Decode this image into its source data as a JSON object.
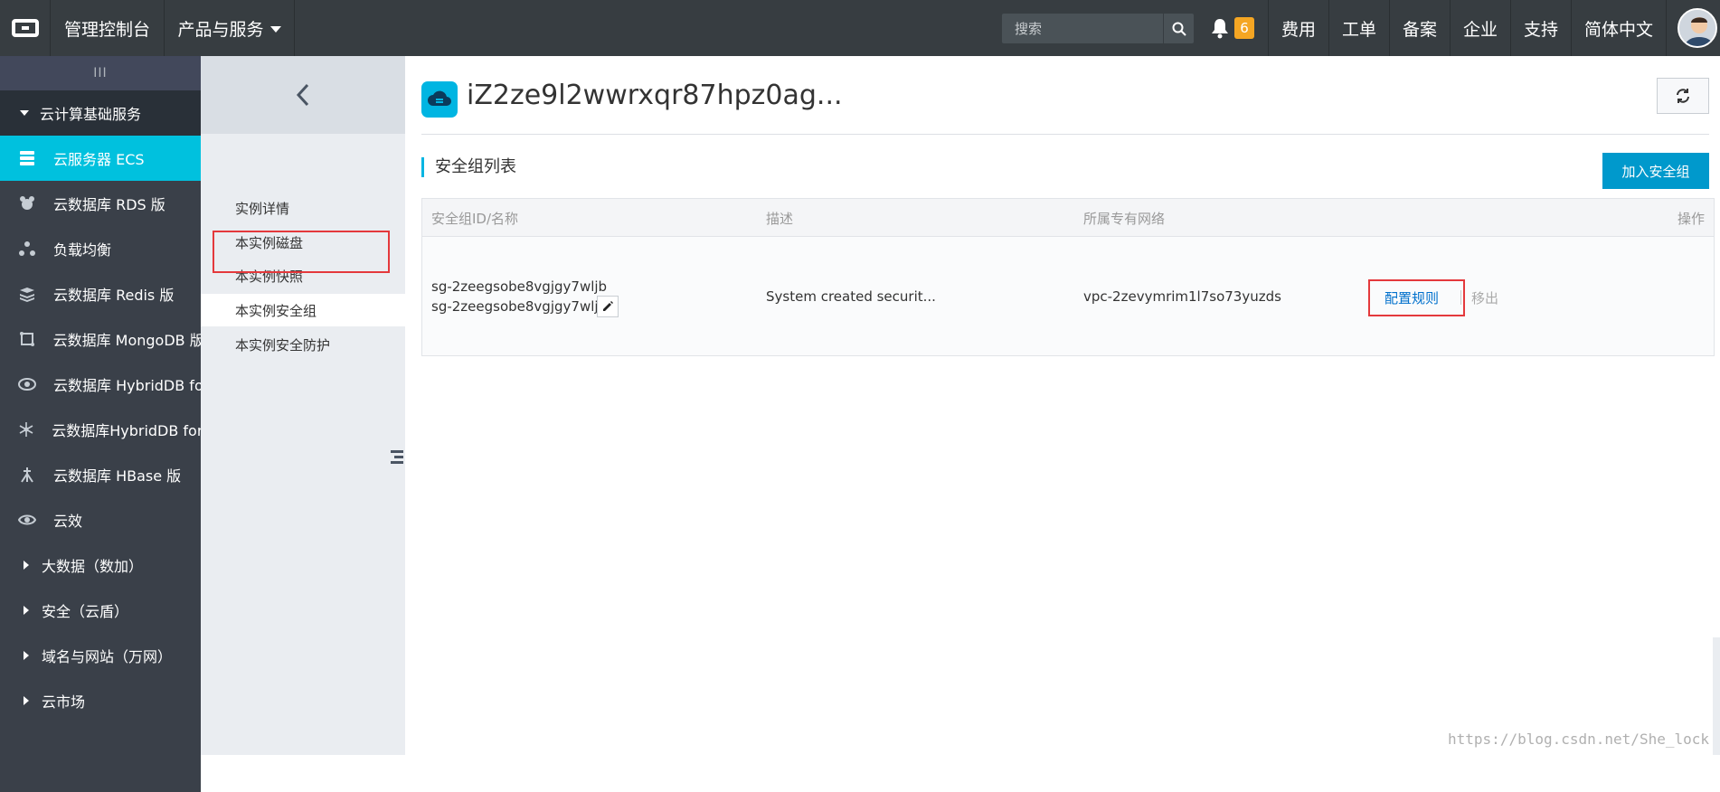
{
  "topbar": {
    "console": "管理控制台",
    "products": "产品与服务",
    "search_placeholder": "搜索",
    "notif_count": "6",
    "links": [
      "费用",
      "工单",
      "备案",
      "企业",
      "支持",
      "简体中文"
    ]
  },
  "leftnav": {
    "handle": "III",
    "section_main": "云计算基础服务",
    "items": [
      {
        "label": "云服务器 ECS",
        "icon": "server-icon"
      },
      {
        "label": "云数据库 RDS 版",
        "icon": "rds-icon"
      },
      {
        "label": "负载均衡",
        "icon": "load-balancer-icon"
      },
      {
        "label": "云数据库 Redis 版",
        "icon": "redis-icon"
      },
      {
        "label": "云数据库 MongoDB 版",
        "icon": "mongodb-icon"
      },
      {
        "label": "云数据库 HybridDB fo...",
        "icon": "hybriddb-icon"
      },
      {
        "label": "云数据库HybridDB for...",
        "icon": "hybriddb-star-icon"
      },
      {
        "label": "云数据库 HBase 版",
        "icon": "hbase-icon"
      },
      {
        "label": "云效",
        "icon": "eye-icon"
      }
    ],
    "sections_collapsed": [
      "大数据（数加）",
      "安全（云盾）",
      "域名与网站（万网）",
      "云市场"
    ]
  },
  "subnav": {
    "items": [
      "实例详情",
      "本实例磁盘",
      "本实例快照",
      "本实例安全组",
      "本实例安全防护"
    ],
    "active": "本实例安全组"
  },
  "main": {
    "instance_title": "iZ2ze9l2wwrxqr87hpz0ag...",
    "section_title": "安全组列表",
    "add_button": "加入安全组",
    "table": {
      "headers": [
        "安全组ID/名称",
        "描述",
        "所属专有网络",
        "操作"
      ],
      "rows": [
        {
          "id": "sg-2zeegsobe8vgjgy7wljb",
          "name": "sg-2zeegsobe8vgjgy7wlj...",
          "description": "System created securit...",
          "vpc": "vpc-2zevymrim1l7so73yuzds",
          "action_config": "配置规则",
          "action_remove": "移出"
        }
      ]
    }
  },
  "watermark": "https://blog.csdn.net/She_lock",
  "colors": {
    "topbar": "#373d41",
    "accent": "#00c1de",
    "primary_button": "#0099cc",
    "highlight": "#e4393c"
  }
}
